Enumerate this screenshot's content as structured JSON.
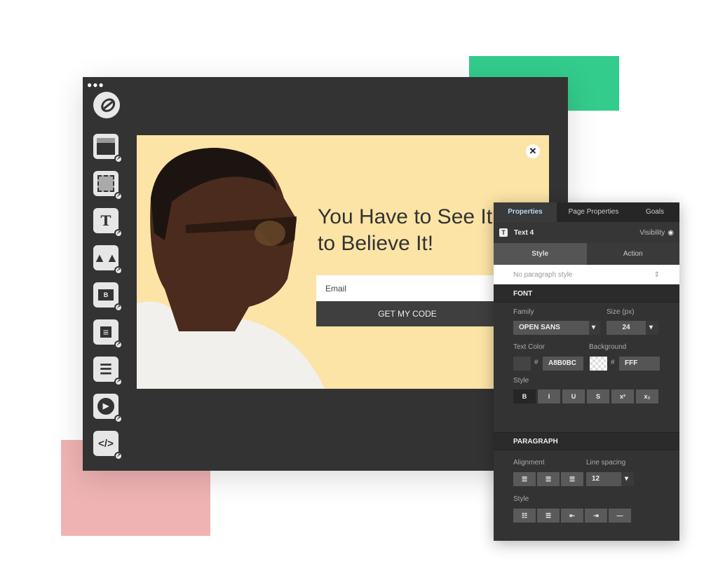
{
  "colors": {
    "green_accent": "#33cc8c",
    "pink_accent": "#efb3b3",
    "popup_bg": "#fce4a6",
    "editor_bg": "#333333"
  },
  "sidebar": {
    "logo": "unbounce-logo",
    "tools": [
      "section-icon",
      "box-icon",
      "text-icon",
      "image-icon",
      "button-icon",
      "form-icon",
      "list-icon",
      "video-icon",
      "code-icon"
    ],
    "text_tool_glyph": "T"
  },
  "popup": {
    "headline": "You Have to See It\nto Believe It!",
    "email_placeholder": "Email",
    "cta": "GET MY CODE",
    "close": "✕"
  },
  "panel": {
    "tabs": [
      "Properties",
      "Page Properties",
      "Goals"
    ],
    "element_icon": "T",
    "element_name": "Text 4",
    "visibility": "Visibility",
    "subtabs": [
      "Style",
      "Action"
    ],
    "paragraph_style": "No paragraph style",
    "font": {
      "title": "FONT",
      "family_label": "Family",
      "family": "OPEN SANS",
      "size_label": "Size (px)",
      "size": "24",
      "text_color_label": "Text Color",
      "text_color": "A8B0BC",
      "background_label": "Background",
      "background": "FFF",
      "hash": "#",
      "style_label": "Style",
      "styles": [
        "B",
        "I",
        "U",
        "S",
        "x²",
        "x₂"
      ]
    },
    "paragraph": {
      "title": "PARAGRAPH",
      "alignment_label": "Alignment",
      "line_spacing_label": "Line spacing",
      "line_spacing": "12",
      "style_label": "Style"
    }
  }
}
